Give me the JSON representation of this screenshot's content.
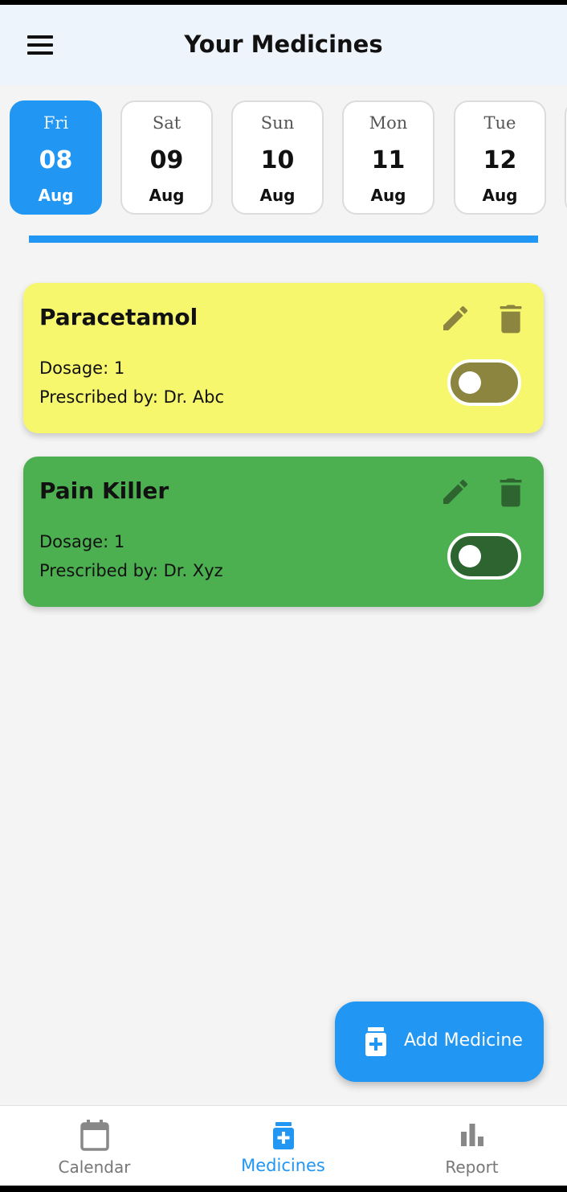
{
  "header": {
    "title": "Your Medicines",
    "menu_icon": "hamburger-menu-icon"
  },
  "days": [
    {
      "name": "Fri",
      "num": "08",
      "month": "Aug",
      "active": true
    },
    {
      "name": "Sat",
      "num": "09",
      "month": "Aug",
      "active": false
    },
    {
      "name": "Sun",
      "num": "10",
      "month": "Aug",
      "active": false
    },
    {
      "name": "Mon",
      "num": "11",
      "month": "Aug",
      "active": false
    },
    {
      "name": "Tue",
      "num": "12",
      "month": "Aug",
      "active": false
    }
  ],
  "medicines": [
    {
      "name": "Paracetamol",
      "dosage": "Dosage: 1",
      "prescribed": "Prescribed by: Dr. Abc",
      "color": "#f7f76e",
      "enabled": false
    },
    {
      "name": "Pain Killer",
      "dosage": "Dosage: 1",
      "prescribed": "Prescribed by: Dr. Xyz",
      "color": "#4caf50",
      "enabled": false
    }
  ],
  "fab": {
    "label": "Add Medicine",
    "icon": "medicine-bottle-add-icon"
  },
  "nav": [
    {
      "label": "Calendar",
      "icon": "calendar-icon",
      "active": false
    },
    {
      "label": "Medicines",
      "icon": "medicine-bottle-icon",
      "active": true
    },
    {
      "label": "Report",
      "icon": "bar-chart-icon",
      "active": false
    }
  ],
  "colors": {
    "accent": "#2196f3",
    "background": "#f4f4f4",
    "appbar": "#eef4fb"
  }
}
